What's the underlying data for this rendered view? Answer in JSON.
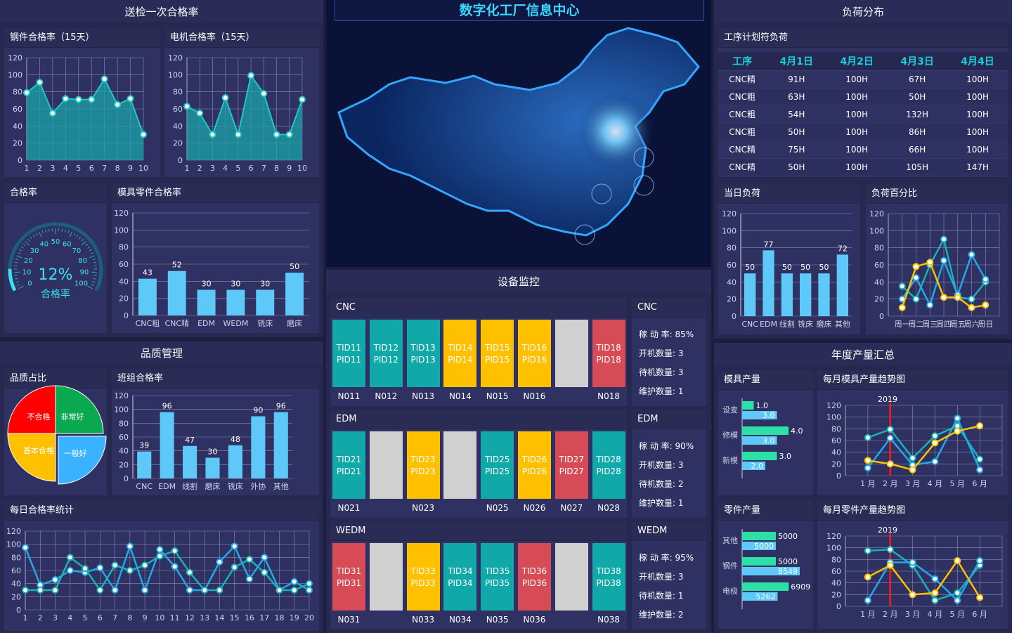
{
  "header": {
    "title": "数字化工厂信息中心"
  },
  "left": {
    "section1": {
      "title": "送检一次合格率"
    },
    "section2": {
      "title": "品质管理"
    },
    "steel_chart": {
      "title": "钢件合格率（15天）",
      "ylabels": [
        "0",
        "20",
        "40",
        "60",
        "80",
        "100",
        "120"
      ],
      "xlabels": [
        "1",
        "2",
        "3",
        "4",
        "5",
        "6",
        "7",
        "8",
        "9",
        "10"
      ]
    },
    "motor_chart": {
      "title": "电机合格率（15天）",
      "ylabels": [
        "0",
        "20",
        "40",
        "60",
        "80",
        "100",
        "120"
      ],
      "xlabels": [
        "1",
        "2",
        "3",
        "4",
        "5",
        "6",
        "7",
        "8",
        "9",
        "10"
      ]
    },
    "gauge": {
      "title": "合格率",
      "value": "12%",
      "label": "合格率",
      "ticks": [
        "0",
        "10",
        "20",
        "30",
        "40",
        "50",
        "60",
        "70",
        "80",
        "90",
        "100"
      ]
    },
    "mold_parts": {
      "title": "模具零件合格率",
      "ylabels": [
        "0",
        "20",
        "40",
        "60",
        "80",
        "100",
        "120"
      ]
    },
    "quality_ratio": {
      "title": "品质占比",
      "slices": [
        "不合格",
        "非常好",
        "基本合格",
        "一般好"
      ]
    },
    "team_rate": {
      "title": "班组合格率",
      "ylabels": [
        "0",
        "20",
        "40",
        "60",
        "80",
        "100",
        "120"
      ]
    },
    "daily_rate": {
      "title": "每日合格率统计",
      "ylabels": [
        "0",
        "20",
        "40",
        "60",
        "80",
        "100",
        "120"
      ],
      "xlabels": [
        "1",
        "2",
        "3",
        "4",
        "5",
        "6",
        "7",
        "8",
        "9",
        "10",
        "11",
        "12",
        "13",
        "14",
        "15",
        "16",
        "17",
        "18",
        "19",
        "20"
      ]
    }
  },
  "middle": {
    "monitor": {
      "title": "设备监控"
    },
    "groups": [
      {
        "name": "CNC",
        "tiles": [
          {
            "l1": "TID11",
            "l2": "PID11",
            "label": "N011",
            "color": "#10a8a8"
          },
          {
            "l1": "TID12",
            "l2": "PID12",
            "label": "N012",
            "color": "#10a8a8"
          },
          {
            "l1": "TID13",
            "l2": "PID13",
            "label": "N013",
            "color": "#10a8a8"
          },
          {
            "l1": "TID14",
            "l2": "PID14",
            "label": "N014",
            "color": "#ffc000"
          },
          {
            "l1": "TID15",
            "l2": "PID15",
            "label": "N015",
            "color": "#ffc000"
          },
          {
            "l1": "TID16",
            "l2": "PID16",
            "label": "N016",
            "color": "#ffc000"
          },
          {
            "l1": "",
            "l2": "",
            "label": "",
            "color": "#d0d0d0"
          },
          {
            "l1": "TID18",
            "l2": "PID18",
            "label": "N018",
            "color": "#d64b55"
          }
        ],
        "stats": {
          "title": "CNC",
          "rate": "稼 动 率: 85%",
          "on": "开机数量: 3",
          "wait": "待机数量: 3",
          "maint": "维护数量: 1"
        }
      },
      {
        "name": "EDM",
        "tiles": [
          {
            "l1": "TID21",
            "l2": "PID21",
            "label": "N021",
            "color": "#10a8a8"
          },
          {
            "l1": "",
            "l2": "",
            "label": "",
            "color": "#d0d0d0"
          },
          {
            "l1": "TID23",
            "l2": "PID23",
            "label": "N023",
            "color": "#ffc000"
          },
          {
            "l1": "",
            "l2": "",
            "label": "",
            "color": "#d0d0d0"
          },
          {
            "l1": "TID25",
            "l2": "PID25",
            "label": "N025",
            "color": "#10a8a8"
          },
          {
            "l1": "TID26",
            "l2": "PID26",
            "label": "N026",
            "color": "#ffc000"
          },
          {
            "l1": "TID27",
            "l2": "PID27",
            "label": "N027",
            "color": "#d64b55"
          },
          {
            "l1": "TID28",
            "l2": "PID28",
            "label": "N028",
            "color": "#10a8a8"
          }
        ],
        "stats": {
          "title": "EDM",
          "rate": "稼 动 率: 90%",
          "on": "开机数量: 3",
          "wait": "待机数量: 2",
          "maint": "维护数量: 1"
        }
      },
      {
        "name": "WEDM",
        "tiles": [
          {
            "l1": "TID31",
            "l2": "PID31",
            "label": "N031",
            "color": "#d64b55"
          },
          {
            "l1": "",
            "l2": "",
            "label": "",
            "color": "#d0d0d0"
          },
          {
            "l1": "TID33",
            "l2": "PID33",
            "label": "N033",
            "color": "#ffc000"
          },
          {
            "l1": "TID34",
            "l2": "PID34",
            "label": "N034",
            "color": "#10a8a8"
          },
          {
            "l1": "TID35",
            "l2": "PID35",
            "label": "N035",
            "color": "#10a8a8"
          },
          {
            "l1": "TID36",
            "l2": "PID36",
            "label": "N036",
            "color": "#d64b55"
          },
          {
            "l1": "",
            "l2": "",
            "label": "",
            "color": "#d0d0d0"
          },
          {
            "l1": "TID38",
            "l2": "PID38",
            "label": "N038",
            "color": "#10a8a8"
          }
        ],
        "stats": {
          "title": "WEDM",
          "rate": "稼 动 率: 95%",
          "on": "开机数量: 3",
          "wait": "待机数量: 1",
          "maint": "维护数量: 2"
        }
      }
    ]
  },
  "right": {
    "load": {
      "title": "负荷分布"
    },
    "plan": {
      "title": "工序计划符负荷",
      "headers": [
        "工序",
        "4月1日",
        "4月2日",
        "4月3日",
        "4月4日"
      ],
      "rows": [
        [
          "CNC精",
          "91H",
          "100H",
          "67H",
          "100H"
        ],
        [
          "CNC粗",
          "63H",
          "100H",
          "50H",
          "100H"
        ],
        [
          "CNC粗",
          "54H",
          "100H",
          "132H",
          "100H"
        ],
        [
          "CNC粗",
          "50H",
          "100H",
          "86H",
          "100H"
        ],
        [
          "CNC精",
          "75H",
          "100H",
          "66H",
          "100H"
        ],
        [
          "CNC精",
          "50H",
          "100H",
          "105H",
          "147H"
        ]
      ]
    },
    "today": {
      "title": "当日负荷",
      "ylabels": [
        "0",
        "20",
        "40",
        "60",
        "80",
        "100",
        "120"
      ]
    },
    "percent": {
      "title": "负荷百分比",
      "ylabels": [
        "0",
        "20",
        "40",
        "60",
        "80",
        "100",
        "120"
      ],
      "xlabels": [
        "周一",
        "周二",
        "周三",
        "周四",
        "周五",
        "周六",
        "周日"
      ]
    },
    "annual": {
      "title": "年度产量汇总"
    },
    "mold_output": {
      "title": "模具产量"
    },
    "part_output": {
      "title": "零件产量"
    },
    "mold_trend": {
      "title": "每月模具产量趋势图",
      "year": "2019",
      "ylabels": [
        "0",
        "20",
        "40",
        "60",
        "80",
        "100",
        "120"
      ],
      "xlabels": [
        "1 月",
        "2 月",
        "3 月",
        "4 月",
        "5 月",
        "6 月"
      ]
    },
    "part_trend": {
      "title": "每月零件产量趋势图",
      "year": "2019",
      "ylabels": [
        "0",
        "20",
        "40",
        "60",
        "80",
        "100",
        "120"
      ],
      "xlabels": [
        "1 月",
        "2 月",
        "3 月",
        "4 月",
        "5 月",
        "6 月"
      ]
    }
  },
  "chart_data": [
    {
      "type": "area",
      "id": "steel",
      "x": [
        1,
        2,
        3,
        4,
        5,
        6,
        7,
        8,
        9,
        10
      ],
      "values": [
        79,
        91,
        55,
        72,
        71,
        71,
        95,
        65,
        72,
        30
      ],
      "ylim": [
        0,
        120
      ]
    },
    {
      "type": "area",
      "id": "motor",
      "x": [
        1,
        2,
        3,
        4,
        5,
        6,
        7,
        8,
        9,
        10
      ],
      "values": [
        63,
        55,
        30,
        73,
        30,
        99,
        78,
        30,
        30,
        71
      ],
      "ylim": [
        0,
        120
      ]
    },
    {
      "type": "bar",
      "id": "mold_parts",
      "categories": [
        "CNC粗",
        "CNC精",
        "EDM",
        "WEDM",
        "铣床",
        "磨床"
      ],
      "values": [
        43,
        52,
        30,
        30,
        30,
        50
      ],
      "ylim": [
        0,
        120
      ]
    },
    {
      "type": "pie",
      "id": "quality_ratio",
      "categories": [
        "不合格",
        "非常好",
        "基本合格",
        "一般好"
      ],
      "values": [
        25,
        25,
        25,
        25
      ]
    },
    {
      "type": "bar",
      "id": "team_rate",
      "categories": [
        "CNC",
        "EDM",
        "线割",
        "磨床",
        "铣床",
        "外协",
        "其他"
      ],
      "values": [
        39,
        96,
        47,
        30,
        48,
        90,
        96
      ],
      "ylim": [
        0,
        120
      ]
    },
    {
      "type": "line",
      "id": "daily",
      "x": [
        1,
        2,
        3,
        4,
        5,
        6,
        7,
        8,
        9,
        10,
        11,
        12,
        13,
        14,
        15,
        16,
        17,
        18,
        19,
        20
      ],
      "series": [
        {
          "values": [
            95,
            38,
            46,
            60,
            57,
            64,
            30,
            97,
            30,
            92,
            66,
            30,
            30,
            73,
            97,
            47,
            80,
            30,
            43,
            30
          ]
        },
        {
          "values": [
            30,
            30,
            30,
            80,
            63,
            30,
            68,
            60,
            68,
            82,
            90,
            57,
            30,
            30,
            65,
            77,
            57,
            30,
            30,
            40
          ]
        }
      ],
      "ylim": [
        0,
        120
      ]
    },
    {
      "type": "bar",
      "id": "today",
      "categories": [
        "CNC",
        "EDM",
        "线割",
        "铣床",
        "磨床",
        "其他"
      ],
      "values": [
        50,
        77,
        50,
        50,
        50,
        72
      ],
      "ylim": [
        0,
        120
      ]
    },
    {
      "type": "line",
      "id": "percent",
      "categories": [
        "周一",
        "周二",
        "周三",
        "周四",
        "周五",
        "周六",
        "周日"
      ],
      "series": [
        {
          "values": [
            35,
            20,
            60,
            90,
            22,
            20,
            40
          ]
        },
        {
          "values": [
            20,
            45,
            13,
            65,
            25,
            72,
            43
          ]
        },
        {
          "values": [
            10,
            58,
            63,
            22,
            22,
            10,
            13
          ]
        }
      ],
      "ylim": [
        0,
        120
      ]
    },
    {
      "type": "bar",
      "id": "mold_output",
      "orientation": "horizontal",
      "categories": [
        "设变",
        "修模",
        "新模"
      ],
      "series": [
        {
          "values": [
            1.0,
            4.0,
            3.0
          ]
        },
        {
          "values": [
            3.0,
            3.0,
            2.0
          ]
        }
      ]
    },
    {
      "type": "bar",
      "id": "part_output",
      "orientation": "horizontal",
      "categories": [
        "其他",
        "钢件",
        "电极"
      ],
      "series": [
        {
          "values": [
            5000,
            5000,
            6909
          ]
        },
        {
          "values": [
            5000,
            8549,
            5262
          ]
        }
      ]
    },
    {
      "type": "line",
      "id": "mold_trend",
      "categories": [
        "1 月",
        "2 月",
        "3 月",
        "4 月",
        "5 月",
        "6 月"
      ],
      "series": [
        {
          "values": [
            65,
            79,
            30,
            68,
            85,
            28
          ]
        },
        {
          "values": [
            13,
            64,
            18,
            24,
            98,
            10
          ]
        },
        {
          "values": [
            26,
            20,
            10,
            56,
            76,
            85
          ]
        }
      ],
      "ylim": [
        0,
        120
      ]
    },
    {
      "type": "line",
      "id": "part_trend",
      "categories": [
        "1 月",
        "2 月",
        "3 月",
        "4 月",
        "5 月",
        "6 月"
      ],
      "series": [
        {
          "values": [
            95,
            97,
            70,
            10,
            23,
            70
          ]
        },
        {
          "values": [
            10,
            75,
            75,
            47,
            10,
            78
          ]
        },
        {
          "values": [
            50,
            70,
            20,
            23,
            78,
            15
          ]
        }
      ],
      "ylim": [
        0,
        120
      ]
    }
  ]
}
